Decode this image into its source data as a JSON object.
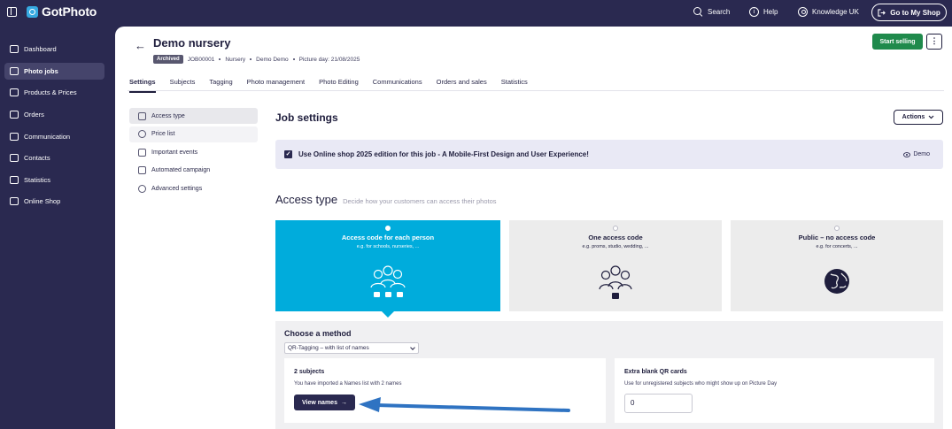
{
  "topbar": {
    "brand": "GotPhoto",
    "search": "Search",
    "help": "Help",
    "knowledge": "Knowledge UK",
    "shop_button": "Go to My Shop"
  },
  "sidebar": {
    "items": [
      {
        "label": "Dashboard",
        "icon": "dashboard-icon",
        "active": false
      },
      {
        "label": "Photo jobs",
        "icon": "photo-icon",
        "active": true
      },
      {
        "label": "Products & Prices",
        "icon": "cart-icon",
        "active": false
      },
      {
        "label": "Orders",
        "icon": "box-icon",
        "active": false
      },
      {
        "label": "Communication",
        "icon": "chat-icon",
        "active": false
      },
      {
        "label": "Contacts",
        "icon": "contacts-icon",
        "active": false
      },
      {
        "label": "Statistics",
        "icon": "chart-icon",
        "active": false
      },
      {
        "label": "Online Shop",
        "icon": "shop-icon",
        "active": false
      }
    ]
  },
  "header": {
    "title": "Demo nursery",
    "badge": "Archived",
    "job_id": "JOB00001",
    "type": "Nursery",
    "owner": "Demo Demo",
    "picture_day": "Picture day: 21/08/2025",
    "start_selling": "Start selling",
    "more": "⋮"
  },
  "tabs": [
    "Settings",
    "Subjects",
    "Tagging",
    "Photo management",
    "Photo Editing",
    "Communications",
    "Orders and sales",
    "Statistics"
  ],
  "subnav": [
    "Access type",
    "Price list",
    "Important events",
    "Automated campaign",
    "Advanced settings"
  ],
  "job_settings": {
    "title": "Job settings",
    "actions": "Actions",
    "notice": "Use Online shop 2025 edition for this job - A Mobile-First Design and User Experience!",
    "notice_checked": true,
    "demo": "Demo"
  },
  "access": {
    "title": "Access type",
    "subtitle": "Decide how your customers can access their photos",
    "cards": [
      {
        "title": "Access code for each person",
        "sub": "e.g. for schools, nurseries, ...",
        "selected": true
      },
      {
        "title": "One access code",
        "sub": "e.g. proms, studio, wedding, ...",
        "selected": false
      },
      {
        "title": "Public – no access code",
        "sub": "e.g. for concerts, ...",
        "selected": false
      }
    ],
    "accent": "#00acdc"
  },
  "method": {
    "title": "Choose a method",
    "selected": "QR-Tagging – with list of names",
    "subjects_title": "2 subjects",
    "subjects_text": "You have imported a Names list with 2 names",
    "view_names": "View names",
    "blank_title": "Extra blank QR cards",
    "blank_text": "Use for unregistered subjects who might show up on Picture Day",
    "blank_value": "0"
  }
}
